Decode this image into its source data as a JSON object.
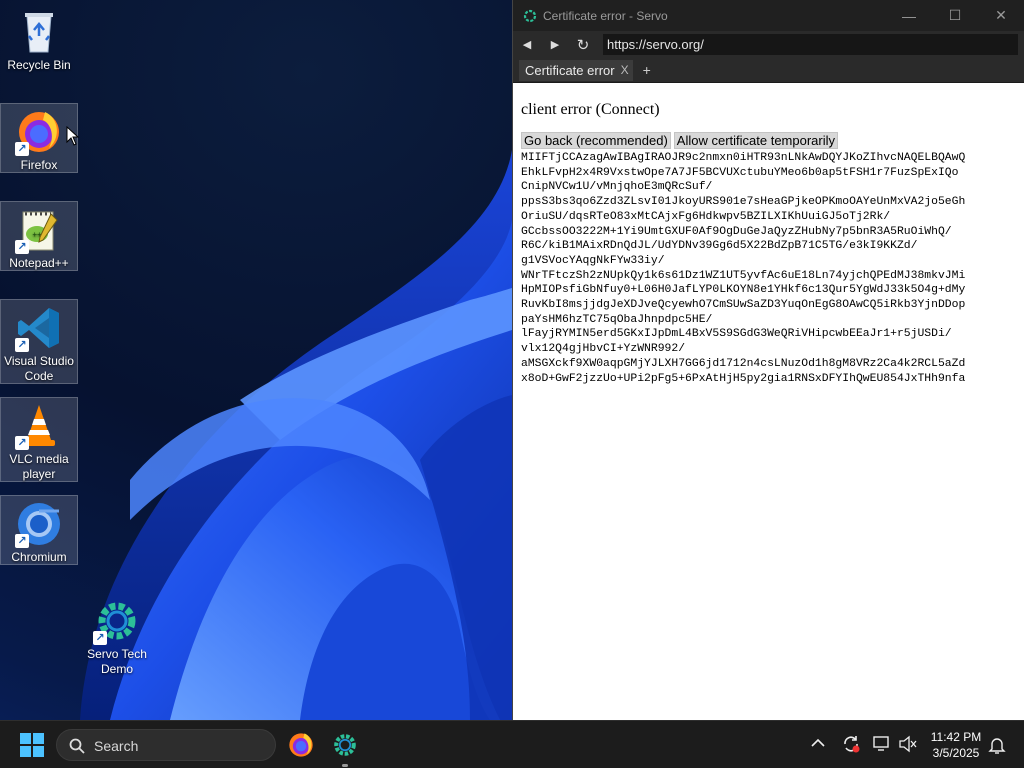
{
  "desktop": {
    "icons": [
      {
        "label": "Recycle Bin",
        "icon": "recycle-bin-icon"
      },
      {
        "label": "Firefox",
        "icon": "firefox-icon"
      },
      {
        "label": "Notepad++",
        "icon": "notepad-plus-plus-icon"
      },
      {
        "label": "Visual Studio Code",
        "icon": "vscode-icon"
      },
      {
        "label": "VLC media player",
        "icon": "vlc-icon"
      },
      {
        "label": "Chromium",
        "icon": "chromium-icon"
      },
      {
        "label": "Servo Tech Demo",
        "icon": "servo-icon"
      }
    ]
  },
  "browser": {
    "title": "Certificate error - Servo",
    "url": "https://servo.org/",
    "tab_label": "Certificate error",
    "tab_close": "X",
    "new_tab": "+",
    "controls": {
      "minimize": "—",
      "maximize": "☐",
      "close": "✕"
    },
    "nav": {
      "back": "◀",
      "forward": "▶",
      "reload": "↻"
    }
  },
  "page": {
    "heading": "client error (Connect)",
    "go_back_button": "Go back (recommended)",
    "allow_button": "Allow certificate temporarily",
    "certificate_lines": [
      "MIIFTjCCAzagAwIBAgIRAOJR9c2nmxn0iHTR93nLNkAwDQYJKoZIhvcNAQELBQAwQ",
      "EhkLFvpH2x4R9VxstwOpe7A7JF5BCVUXctubuYMeo6b0ap5tFSH1r7FuzSpExIQo",
      "CnipNVCw1U/vMnjqhoE3mQRcSuf/",
      "ppsS3bs3qo6Zzd3ZLsvI01JkoyURS901e7sHeaGPjkeOPKmoOAYeUnMxVA2jo5eGh",
      "OriuSU/dqsRTeO83xMtCAjxFg6Hdkwpv5BZILXIKhUuiGJ5oTj2Rk/",
      "GCcbssOO3222M+1Yi9UmtGXUF0Af9OgDuGeJaQyzZHubNy7p5bnR3A5RuOiWhQ/",
      "R6C/kiB1MAixRDnQdJL/UdYDNv39Gg6d5X22BdZpB71C5TG/e3kI9KKZd/",
      "g1VSVocYAqgNkFYw33iy/",
      "WNrTFtczSh2zNUpkQy1k6s61Dz1WZ1UT5yvfAc6uE18Ln74yjchQPEdMJ38mkvJMi",
      "HpMIOPsfiGbNfuy0+L06H0JafLYP0LKOYN8e1YHkf6c13Qur5YgWdJ33k5O4g+dMy",
      "RuvKbI8msjjdgJeXDJveQcyewhO7CmSUwSaZD3YuqOnEgG8OAwCQ5iRkb3YjnDDop",
      "paYsHM6hzTC75qObaJhnpdpc5HE/",
      "lFayjRYMIN5erd5GKxIJpDmL4BxV5S9SGdG3WeQRiVHipcwbEEaJr1+r5jUSDi/",
      "vlx12Q4gjHbvCI+YzWNR992/",
      "aMSGXckf9XW0aqpGMjYJLXH7GG6jd1712n4csLNuzOd1h8gM8VRz2Ca4k2RCL5aZd",
      "x8oD+GwF2jzzUo+UPi2pFg5+6PxAtHjH5py2gia1RNSxDFYIhQwEU854JxTHh9nfa"
    ]
  },
  "taskbar": {
    "search_label": "Search",
    "time": "11:42 PM",
    "date": "3/5/2025"
  }
}
